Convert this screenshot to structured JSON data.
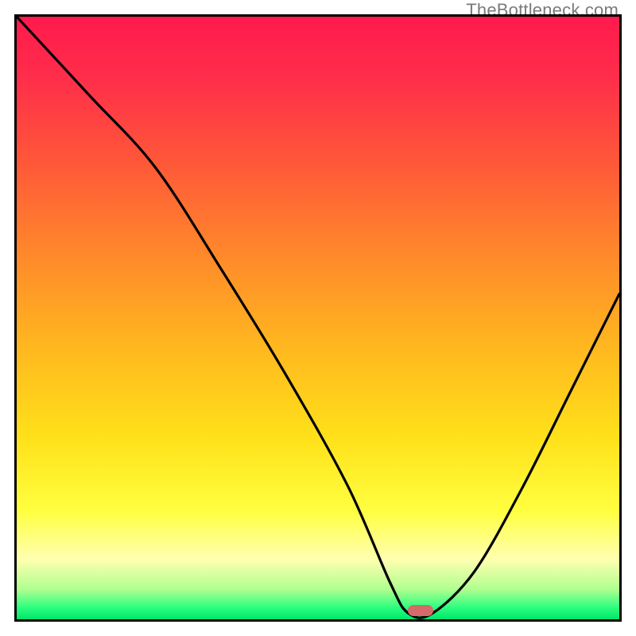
{
  "watermark": "TheBottleneck.com",
  "marker": {
    "x_pct": 67,
    "y_pct": 98.5,
    "color": "#d46a6a"
  },
  "chart_data": {
    "type": "line",
    "title": "",
    "xlabel": "",
    "ylabel": "",
    "xlim": [
      0,
      100
    ],
    "ylim": [
      0,
      100
    ],
    "series": [
      {
        "name": "bottleneck-curve",
        "x": [
          0,
          12,
          23,
          34,
          45,
          55,
          62,
          65,
          69,
          76,
          84,
          92,
          100
        ],
        "values": [
          100,
          87,
          75,
          58,
          40,
          22,
          6,
          1,
          1,
          8,
          22,
          38,
          54
        ]
      }
    ],
    "gradient_stops": [
      {
        "pct": 0,
        "color": "#ff1a4d"
      },
      {
        "pct": 25,
        "color": "#ff5a38"
      },
      {
        "pct": 55,
        "color": "#ffb81f"
      },
      {
        "pct": 82,
        "color": "#ffff40"
      },
      {
        "pct": 95,
        "color": "#b0ff90"
      },
      {
        "pct": 100,
        "color": "#00e66b"
      }
    ],
    "optimal_x_pct": 67
  }
}
